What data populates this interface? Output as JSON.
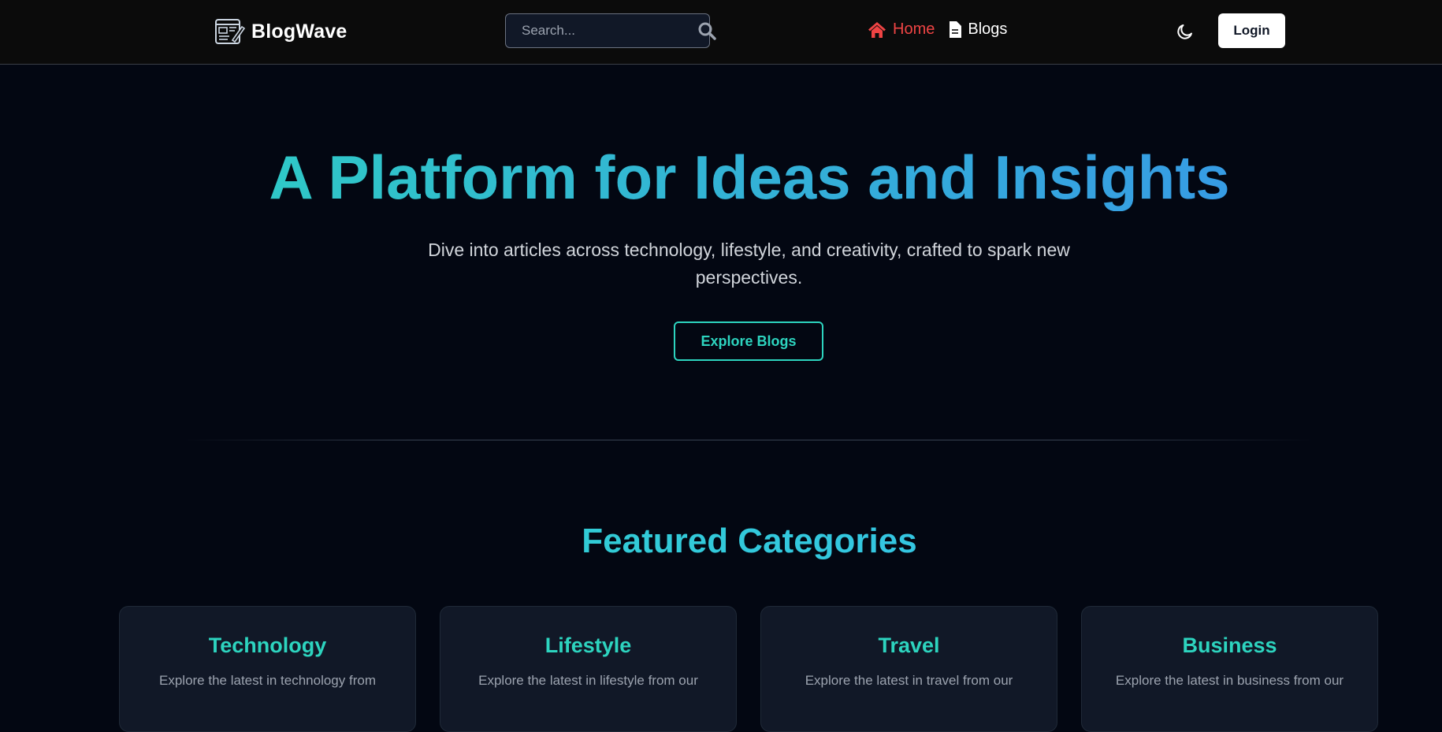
{
  "navbar": {
    "brand": "BlogWave",
    "search": {
      "placeholder": "Search...",
      "icon": "search-icon"
    },
    "links": [
      {
        "label": "Home",
        "icon": "home-icon",
        "active": true,
        "color": "#ef4444"
      },
      {
        "label": "Blogs",
        "icon": "document-icon",
        "active": false
      }
    ],
    "theme_toggle_icon": "moon-icon",
    "login_label": "Login"
  },
  "hero": {
    "title": "A Platform for Ideas and Insights",
    "subtitle": "Dive into articles across technology, lifestyle, and creativity, crafted to spark new perspectives.",
    "cta_label": "Explore Blogs"
  },
  "featured": {
    "title": "Featured Categories",
    "categories": [
      {
        "title": "Technology",
        "description": "Explore the latest in technology from"
      },
      {
        "title": "Lifestyle",
        "description": "Explore the latest in lifestyle from our"
      },
      {
        "title": "Travel",
        "description": "Explore the latest in travel from our"
      },
      {
        "title": "Business",
        "description": "Explore the latest in business from our"
      }
    ]
  },
  "colors": {
    "accent": "#2dd4bf",
    "accent_blue": "#3b82f6",
    "active_link": "#ef4444",
    "background": "#030712",
    "card_background": "#111827"
  }
}
